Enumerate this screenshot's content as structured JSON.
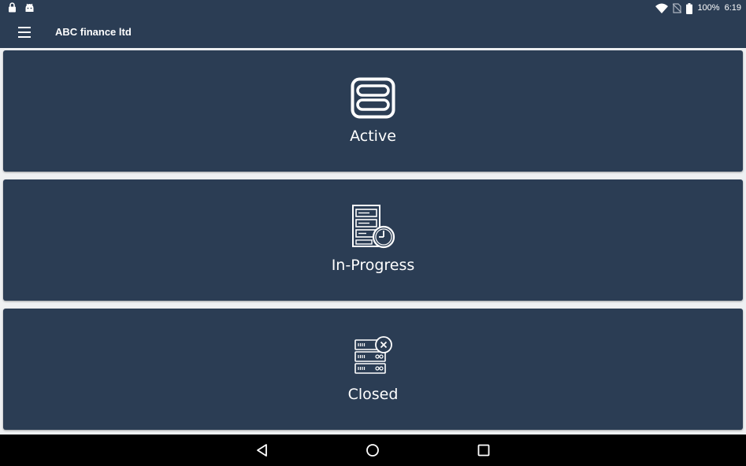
{
  "status_bar": {
    "battery": "100%",
    "time": "6:19",
    "icons": [
      "lock-icon",
      "android-icon",
      "wifi-icon",
      "no-sim-icon",
      "battery-icon"
    ]
  },
  "app_bar": {
    "title": "ABC finance ltd",
    "menu_icon": "hamburger-menu-icon"
  },
  "cards": [
    {
      "label": "Active",
      "icon": "active-list-icon"
    },
    {
      "label": "In-Progress",
      "icon": "in-progress-clock-icon"
    },
    {
      "label": "Closed",
      "icon": "closed-server-icon"
    }
  ],
  "colors": {
    "primary": "#2b3d54",
    "background": "#eef0f2",
    "text": "#ffffff",
    "nav_bar": "#000000"
  },
  "nav_bar": {
    "buttons": [
      "back-icon",
      "home-icon",
      "recents-icon"
    ]
  }
}
